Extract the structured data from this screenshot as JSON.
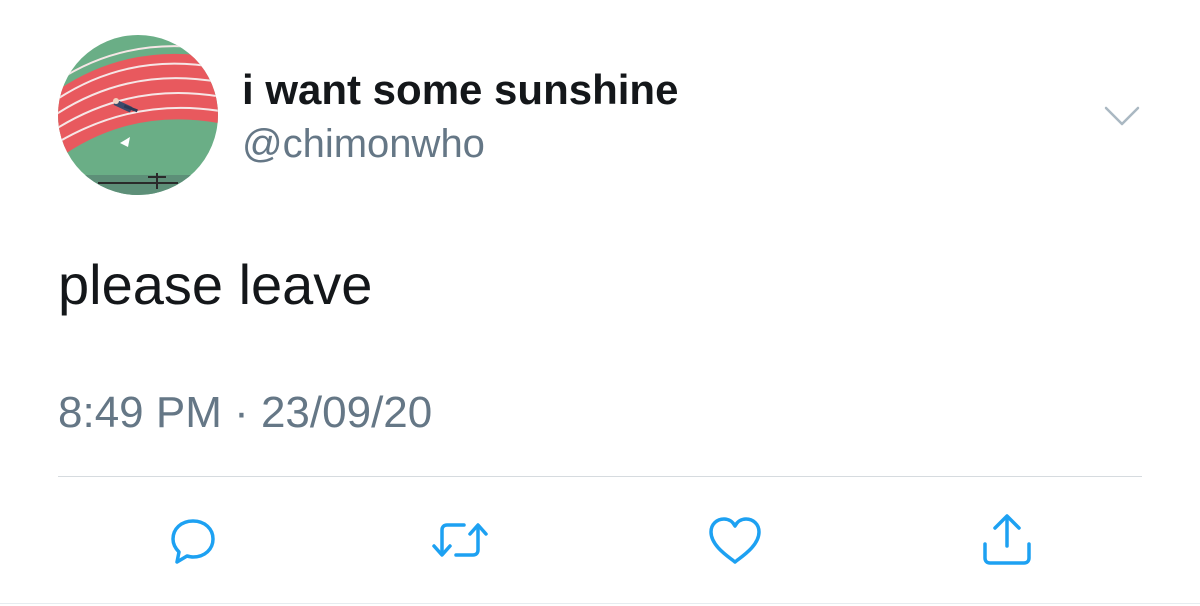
{
  "user": {
    "display_name": "i want some sunshine",
    "handle": "@chimonwho"
  },
  "tweet": {
    "text": "please leave",
    "timestamp": "8:49 PM · 23/09/20"
  },
  "icons": {
    "menu": "chevron-down-icon",
    "reply": "comment-icon",
    "retweet": "retweet-icon",
    "like": "heart-icon",
    "share": "share-icon"
  },
  "colors": {
    "text_primary": "#14171a",
    "text_secondary": "#657786",
    "icon": "#1da1f2",
    "track_red": "#e8595e",
    "field_green": "#5fa77e"
  }
}
